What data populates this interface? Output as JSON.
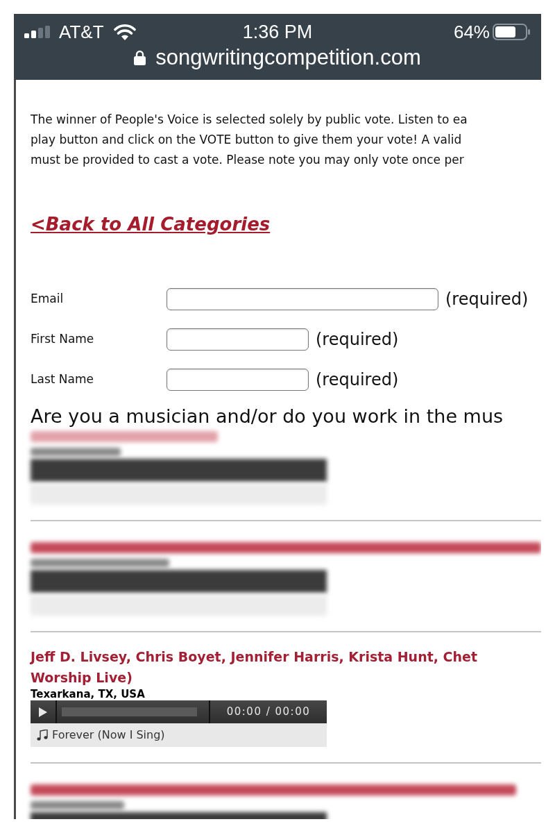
{
  "status_bar": {
    "carrier": "AT&T",
    "time": "1:36 PM",
    "battery": "64%"
  },
  "address_bar": {
    "url": "songwritingcompetition.com"
  },
  "intro": {
    "lines": [
      "The winner of People's Voice is selected solely by public vote. Listen to ea",
      "play button and click on the VOTE button to give them your vote! A valid",
      "must be provided to cast a vote. Please note you may only vote once per"
    ]
  },
  "back_link": "<Back to All Categories",
  "form": {
    "fields": [
      {
        "label": "Email",
        "note": "(required)"
      },
      {
        "label": "First Name",
        "note": "(required)"
      },
      {
        "label": "Last Name",
        "note": "(required)"
      }
    ]
  },
  "question": "Are you a musician and/or do you work in the mus",
  "entries": [
    {
      "kind": "blurred"
    },
    {
      "kind": "blurred"
    },
    {
      "kind": "track",
      "artist_lines": [
        "Jeff D. Livsey, Chris Boyet, Jennifer Harris, Krista Hunt, Chet",
        "Worship Live)"
      ],
      "location": "Texarkana, TX, USA",
      "player": {
        "time": "00:00 / 00:00",
        "track_title": "Forever (Now I Sing)"
      }
    },
    {
      "kind": "blurred"
    }
  ]
}
